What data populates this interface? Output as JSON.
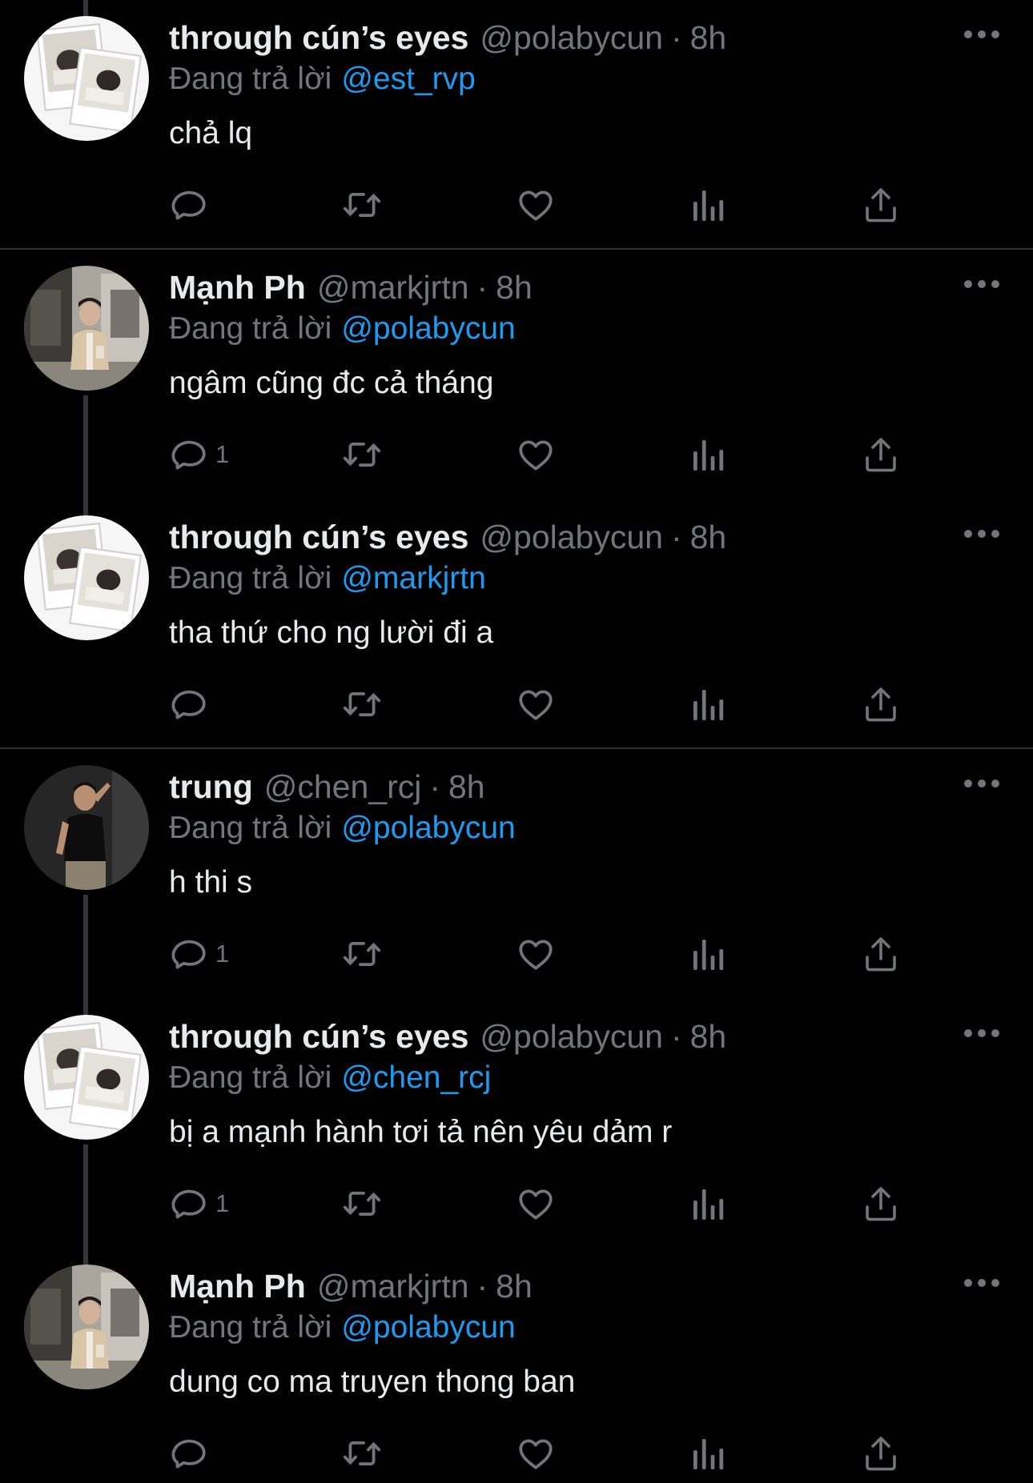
{
  "tweets": [
    {
      "name": "through cún’s eyes",
      "handle": "@polabycun",
      "time": "8h",
      "replying_label": "Đang trả lời",
      "mention": "@est_rvp",
      "text": "chả lq",
      "reply_count": ""
    },
    {
      "name": "Mạnh Ph",
      "handle": "@markjrtn",
      "time": "8h",
      "replying_label": "Đang trả lời",
      "mention": "@polabycun",
      "text": "ngâm cũng đc cả tháng",
      "reply_count": "1"
    },
    {
      "name": "through cún’s eyes",
      "handle": "@polabycun",
      "time": "8h",
      "replying_label": "Đang trả lời",
      "mention": "@markjrtn",
      "text": "tha thứ cho ng lười đi a",
      "reply_count": ""
    },
    {
      "name": "trung",
      "handle": "@chen_rcj",
      "time": "8h",
      "replying_label": "Đang trả lời",
      "mention": "@polabycun",
      "text": "h thi s",
      "reply_count": "1"
    },
    {
      "name": "through cún’s eyes",
      "handle": "@polabycun",
      "time": "8h",
      "replying_label": "Đang trả lời",
      "mention": "@chen_rcj",
      "text": "bị a mạnh hành tơi tả nên yêu dảm r",
      "reply_count": "1"
    },
    {
      "name": "Mạnh Ph",
      "handle": "@markjrtn",
      "time": "8h",
      "replying_label": "Đang trả lời",
      "mention": "@polabycun",
      "text": "dung co ma truyen thong ban",
      "reply_count": ""
    }
  ],
  "meta_separator": "·",
  "icons": {
    "reply": "reply-icon",
    "retweet": "retweet-icon",
    "like": "heart-icon",
    "views": "views-icon",
    "share": "share-icon",
    "more": "more-icon"
  },
  "colors": {
    "background": "#000000",
    "primary_text": "#e7e9ea",
    "secondary_text": "#71767b",
    "link": "#1d9bf0",
    "divider": "#2f3336"
  }
}
